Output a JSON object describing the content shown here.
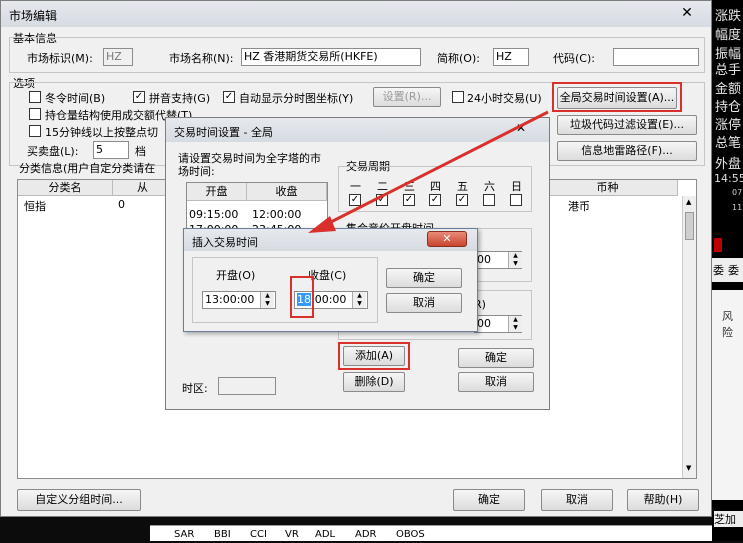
{
  "main": {
    "title": "市场编辑",
    "basic_info_label": "基本信息",
    "market_id_label": "市场标识(M):",
    "market_id_value": "HZ",
    "market_name_label": "市场名称(N):",
    "market_name_value": "HZ 香港期货交易所(HKFE)",
    "short_name_label": "简称(O):",
    "short_name_value": "HZ",
    "code_label": "代码(C):",
    "code_value": "",
    "options_label": "选项",
    "opt_winter": "冬令时间(B)",
    "opt_pinyin": "拼音支持(G)",
    "opt_auto_coords": "自动显示分时图坐标(Y)",
    "settings_button": "设置(R)...",
    "opt_24h": "24小时交易(U)",
    "global_time_button": "全局交易时间设置(A)...",
    "opt_holding": "持仓量结构使用成交额代替(T)",
    "opt_15min": "15分钟线以上按整点切",
    "junk_code_button": "垃圾代码过滤设置(E)...",
    "info_mine_button": "信息地雷路径(F)...",
    "bid_ask_label": "买卖盘(L):",
    "bid_ask_value": "5",
    "level_label": "档",
    "classify_label": "分类信息(用户自定分类请在",
    "col_category": "分类名",
    "col_from": "从",
    "col_currency": "币种",
    "row_name": "恒指",
    "row_from": "0",
    "row_currency": "港币",
    "custom_group_button": "自定义分组时间...",
    "ok_button": "确定",
    "cancel_button": "取消",
    "help_button": "帮助(H)"
  },
  "trading_dialog": {
    "title": "交易时间设置 - 全局",
    "instruction": "请设置交易时间为全字塔的市场时间:",
    "col_open": "开盘",
    "col_close": "收盘",
    "rows": [
      {
        "open": "09:15:00",
        "close": "12:00:00"
      },
      {
        "open": "17:00:00",
        "close": "23:45:00"
      }
    ],
    "cycle_label": "交易周期",
    "weekdays": [
      "一",
      "二",
      "三",
      "四",
      "五",
      "六",
      "日"
    ],
    "auction_label": "集合竞价开盘时间",
    "auction_time_1": "00",
    "auction_time_2": "00",
    "auction_r": "R)",
    "timezone_label": "时区:",
    "add_button": "添加(A)",
    "delete_button": "删除(D)",
    "ok_button": "确定",
    "cancel_button": "取消"
  },
  "insert_dialog": {
    "title": "插入交易时间",
    "open_label": "开盘(O)",
    "close_label": "收盘(C)",
    "open_value": "13:00:00",
    "close_hour": "18",
    "close_rest": ":00:00",
    "ok_button": "确定",
    "cancel_button": "取消"
  },
  "background": {
    "right_labels": [
      "涨跌",
      "幅度",
      "振幅",
      "总手",
      "金额",
      "持仓",
      "涨停",
      "总笔",
      "外盘"
    ],
    "time_text": "14:55",
    "small_nums": [
      "07",
      "11"
    ],
    "tab_labels": [
      "委",
      "委"
    ],
    "risk_label": "风险",
    "bottom_right": "芝加哥",
    "bottom_tabs": [
      "SAR",
      "BBI",
      "CCI",
      "VR",
      "ADL",
      "ADR",
      "OBOS"
    ],
    "bg_tabs": [
      "",
      ""
    ]
  },
  "colors": {
    "red_highlight": "#d9302c",
    "bg_dark": "#0c0c0c"
  }
}
